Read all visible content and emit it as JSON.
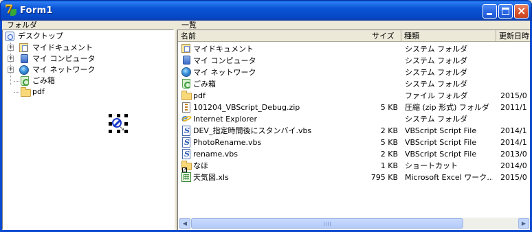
{
  "window": {
    "title": "Form1",
    "accent": "#0a54d6"
  },
  "tree_pane": {
    "label": "フォルダ",
    "root": {
      "label": "デスクトップ",
      "icon": "desktop-icon"
    },
    "items": [
      {
        "label": "マイドキュメント",
        "icon": "my-documents-icon",
        "expandable": true
      },
      {
        "label": "マイ コンピュータ",
        "icon": "my-computer-icon",
        "expandable": true
      },
      {
        "label": "マイ ネットワーク",
        "icon": "network-icon",
        "expandable": true
      },
      {
        "label": "ごみ箱",
        "icon": "recycle-bin-icon",
        "expandable": false
      },
      {
        "label": "pdf",
        "icon": "folder-icon",
        "expandable": false
      }
    ]
  },
  "list_pane": {
    "label": "一覧",
    "columns": {
      "name": "名前",
      "size": "サイズ",
      "type": "種類",
      "date": "更新日時"
    },
    "rows": [
      {
        "name": "マイドキュメント",
        "size": "",
        "type": "システム フォルダ",
        "date": "",
        "icon": "my-documents-icon"
      },
      {
        "name": "マイ コンピュータ",
        "size": "",
        "type": "システム フォルダ",
        "date": "",
        "icon": "my-computer-icon"
      },
      {
        "name": "マイ ネットワーク",
        "size": "",
        "type": "システム フォルダ",
        "date": "",
        "icon": "network-icon"
      },
      {
        "name": "ごみ箱",
        "size": "",
        "type": "システム フォルダ",
        "date": "",
        "icon": "recycle-bin-icon"
      },
      {
        "name": "pdf",
        "size": "",
        "type": "ファイル フォルダ",
        "date": "2015/0",
        "icon": "folder-icon"
      },
      {
        "name": "101204_VBScript_Debug.zip",
        "size": "5 KB",
        "type": "圧縮 (zip 形式) フォルダ",
        "date": "2011/1",
        "icon": "zip-icon"
      },
      {
        "name": "Internet Explorer",
        "size": "",
        "type": "システム フォルダ",
        "date": "",
        "icon": "internet-explorer-icon"
      },
      {
        "name": "DEV_指定時間後にスタンバイ.vbs",
        "size": "2 KB",
        "type": "VBScript Script File",
        "date": "2014/1",
        "icon": "vbscript-file-icon"
      },
      {
        "name": "PhotoRename.vbs",
        "size": "5 KB",
        "type": "VBScript Script File",
        "date": "2014/1",
        "icon": "vbscript-file-icon"
      },
      {
        "name": "rename.vbs",
        "size": "2 KB",
        "type": "VBScript Script File",
        "date": "2013/0",
        "icon": "vbscript-file-icon"
      },
      {
        "name": "なほ",
        "size": "1 KB",
        "type": "ショートカット",
        "date": "2014/0",
        "icon": "shortcut-folder-icon"
      },
      {
        "name": "天気図.xls",
        "size": "795 KB",
        "type": "Microsoft Excel ワーク…",
        "date": "2015/0",
        "icon": "excel-file-icon"
      }
    ]
  },
  "scrollbar": {
    "left_arrow": "◀",
    "right_arrow": "▶"
  }
}
